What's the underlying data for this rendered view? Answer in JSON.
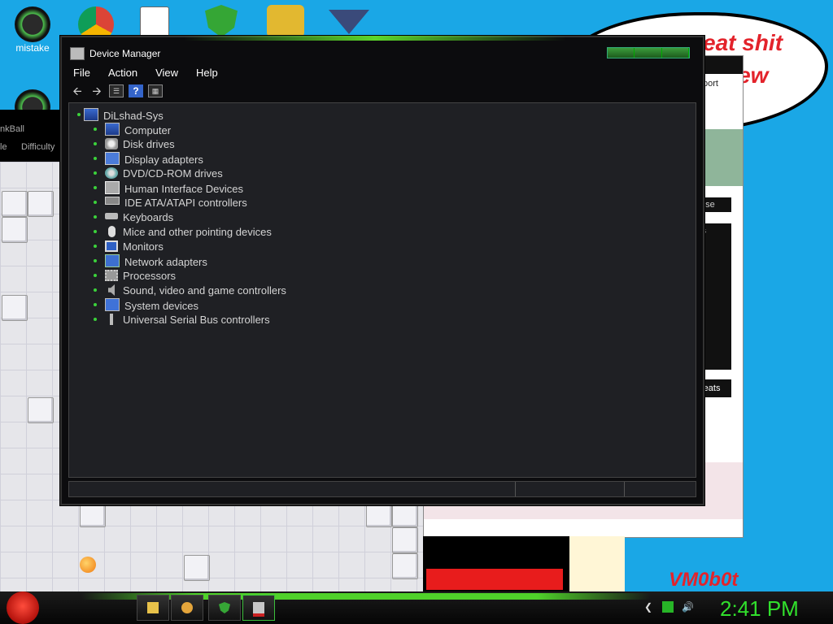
{
  "desktop": {
    "icons": [
      {
        "label": "mistake"
      }
    ]
  },
  "background": {
    "speech_text_1": "eat shit",
    "speech_text_2": "new",
    "back_window_tab": "port",
    "back_window_input": "use",
    "back_window_panel": "s",
    "back_window_button": "reats",
    "watermark": "VM0b0t",
    "game_title": "nkBall",
    "game_menu_1": "le",
    "game_menu_2": "Difficulty"
  },
  "window": {
    "title": "Device Manager",
    "menu": [
      "File",
      "Action",
      "View",
      "Help"
    ],
    "toolbar": [
      "back-icon",
      "forward-icon",
      "properties-icon",
      "help-icon",
      "show-hidden-icon"
    ]
  },
  "tree": {
    "root": "DiLshad-Sys",
    "children": [
      {
        "label": "Computer",
        "icon": "computer-icon"
      },
      {
        "label": "Disk drives",
        "icon": "disk-drive-icon"
      },
      {
        "label": "Display adapters",
        "icon": "display-adapter-icon"
      },
      {
        "label": "DVD/CD-ROM drives",
        "icon": "dvd-icon"
      },
      {
        "label": "Human Interface Devices",
        "icon": "hid-icon"
      },
      {
        "label": "IDE ATA/ATAPI controllers",
        "icon": "ide-controller-icon"
      },
      {
        "label": "Keyboards",
        "icon": "keyboard-icon"
      },
      {
        "label": "Mice and other pointing devices",
        "icon": "mouse-icon"
      },
      {
        "label": "Monitors",
        "icon": "monitor-icon"
      },
      {
        "label": "Network adapters",
        "icon": "network-adapter-icon"
      },
      {
        "label": "Processors",
        "icon": "processor-icon"
      },
      {
        "label": "Sound, video and game controllers",
        "icon": "sound-icon"
      },
      {
        "label": "System devices",
        "icon": "system-devices-icon"
      },
      {
        "label": "Universal Serial Bus controllers",
        "icon": "usb-icon"
      }
    ]
  },
  "taskbar": {
    "clock": "2:41 PM",
    "tray": [
      "chevron-icon",
      "network-icon",
      "volume-icon"
    ]
  },
  "colors": {
    "accent": "#31e02c",
    "window_bg": "#1f2024",
    "desktop": "#1aa7e6"
  }
}
